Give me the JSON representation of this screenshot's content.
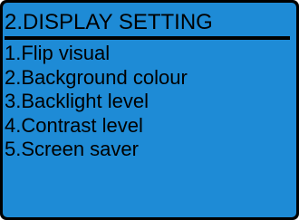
{
  "screen": {
    "title": "2.DISPLAY SETTING",
    "menu_items": [
      {
        "label": "1.Flip visual"
      },
      {
        "label": "2.Background colour"
      },
      {
        "label": "3.Backlight level"
      },
      {
        "label": "4.Contrast level"
      },
      {
        "label": "5.Screen saver"
      }
    ]
  },
  "colors": {
    "screen_background": "#1e8bd6",
    "frame": "#000000",
    "text": "#000000"
  }
}
